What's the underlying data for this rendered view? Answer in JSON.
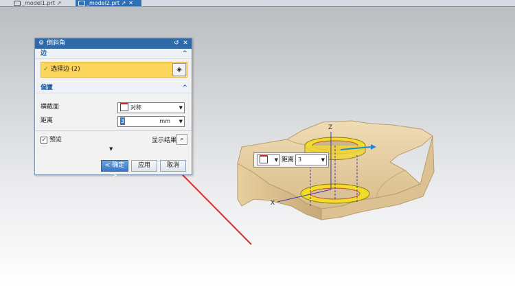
{
  "tabs": [
    {
      "label": "_model1.prt",
      "pin": "↗"
    },
    {
      "label": "_model2.prt",
      "pin": "↗",
      "close": "✕"
    }
  ],
  "dialog": {
    "title": "倒斜角",
    "reset_glyph": "↺",
    "close_glyph": "✕",
    "edge_section": {
      "heading": "边",
      "select_label": "选择边 (2)"
    },
    "offset_section": {
      "heading": "偏置",
      "cross_section_label": "横截面",
      "cross_section_value": "对称",
      "distance_label": "距离",
      "distance_value": "3",
      "distance_unit": "mm"
    },
    "preview_label": "预览",
    "show_result_label": "显示结果",
    "buttons": {
      "ok": "< 确定 >",
      "apply": "应用",
      "cancel": "取消"
    }
  },
  "float_toolbar": {
    "distance_label": "距离",
    "distance_value": "3"
  },
  "axes": {
    "z": "Z",
    "x": "X"
  },
  "colors": {
    "title_bar": "#2f69a8",
    "selection_highlight": "#fbd55c",
    "part_body": "#e9d2a6",
    "chamfer_face": "#f2dc2a",
    "arrow": "#e02a2a",
    "axis_arrow": "#1e88d6"
  }
}
